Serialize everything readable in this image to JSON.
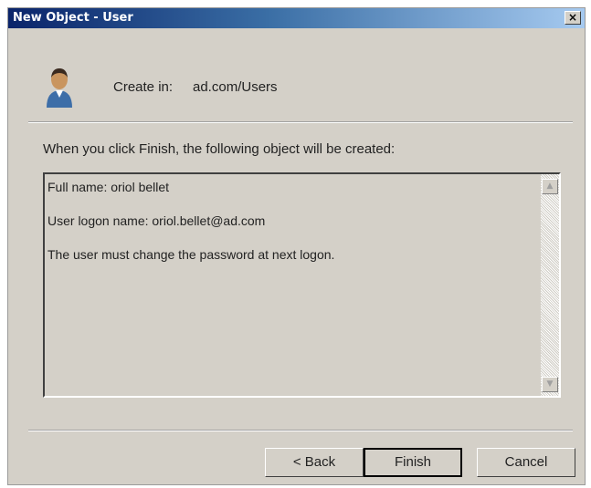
{
  "window": {
    "title": "New Object - User",
    "close_glyph": "×"
  },
  "header": {
    "icon": "user-icon",
    "create_in_label": "Create in:",
    "create_in_value": "ad.com/Users"
  },
  "main": {
    "info_text": "When you click Finish, the following object will be created:",
    "summary_lines": [
      "Full name: oriol bellet",
      "User logon name: oriol.bellet@ad.com",
      "The user must change the password at next logon."
    ],
    "scroll_up_glyph": "▲",
    "scroll_down_glyph": "▼"
  },
  "footer": {
    "back_label": "< Back",
    "finish_label": "Finish",
    "cancel_label": "Cancel"
  },
  "colors": {
    "dialog_background": "#d4d0c8",
    "title_bar_start": "#0a246a",
    "title_bar_end": "#a6caf0"
  }
}
